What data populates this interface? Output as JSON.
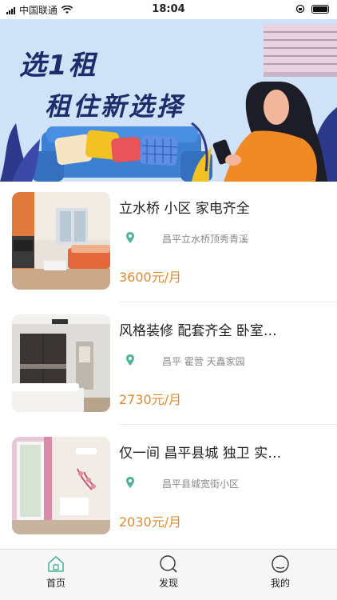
{
  "status_bar": {
    "carrier": "中国联通",
    "time": "18:04",
    "icons": [
      "signal-icon",
      "wifi-icon",
      "orientation-lock-icon",
      "battery-icon"
    ]
  },
  "banner": {
    "line1": "选1租",
    "line2": "租住新选择",
    "colors": {
      "background": "#cfe2f7",
      "title": "#1d2d6b",
      "accent": "#f08a24"
    }
  },
  "listings": [
    {
      "title": "立水桥 小区 家电齐全",
      "address": "昌平立水桥顶秀青溪",
      "price": "3600元/月",
      "photo": "living-room-photo"
    },
    {
      "title": "风格装修 配套齐全 卧室…",
      "address": "昌平 霍营 天鑫家园",
      "price": "2730元/月",
      "photo": "bedroom-photo"
    },
    {
      "title": "仅一间 昌平县城 独卫 实…",
      "address": "昌平县城宽街小区",
      "price": "2030元/月",
      "photo": "room-photo"
    }
  ],
  "tabbar": {
    "tabs": [
      {
        "label": "首页",
        "icon": "home-icon",
        "active": true
      },
      {
        "label": "发现",
        "icon": "discover-icon",
        "active": false
      },
      {
        "label": "我的",
        "icon": "profile-icon",
        "active": false
      }
    ],
    "accent": "#4fb39a"
  },
  "colors": {
    "price": "#e28a2b",
    "location_pin": "#4fb39a"
  }
}
